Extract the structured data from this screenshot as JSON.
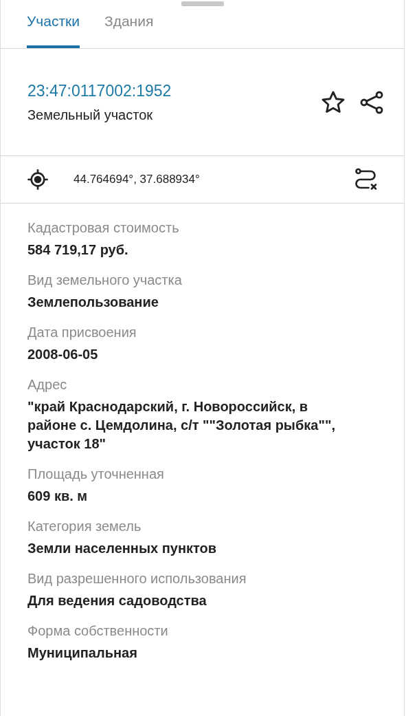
{
  "tabs": [
    {
      "label": "Участки",
      "selected": true
    },
    {
      "label": "Здания",
      "selected": false
    }
  ],
  "parcel": {
    "number": "23:47:0117002:1952",
    "type": "Земельный участок",
    "favorite": false
  },
  "coordinates": "44.764694°, 37.688934°",
  "fields": [
    {
      "label": "Кадастровая стоимость",
      "value": "584 719,17 руб."
    },
    {
      "label": "Вид земельного участка",
      "value": "Землепользование"
    },
    {
      "label": "Дата присвоения",
      "value": "2008-06-05"
    },
    {
      "label": "Адрес",
      "value": "\"край Краснодарский, г. Новороссийск, в районе с. Цемдолина, с/т \"\"Золотая рыбка\"\", участок 18\""
    },
    {
      "label": "Площадь уточненная",
      "value": "609 кв. м"
    },
    {
      "label": "Категория земель",
      "value": "Земли населенных пунктов"
    },
    {
      "label": "Вид разрешенного использования",
      "value": "Для ведения садоводства"
    },
    {
      "label": "Форма собственности",
      "value": "Муниципальная"
    }
  ]
}
